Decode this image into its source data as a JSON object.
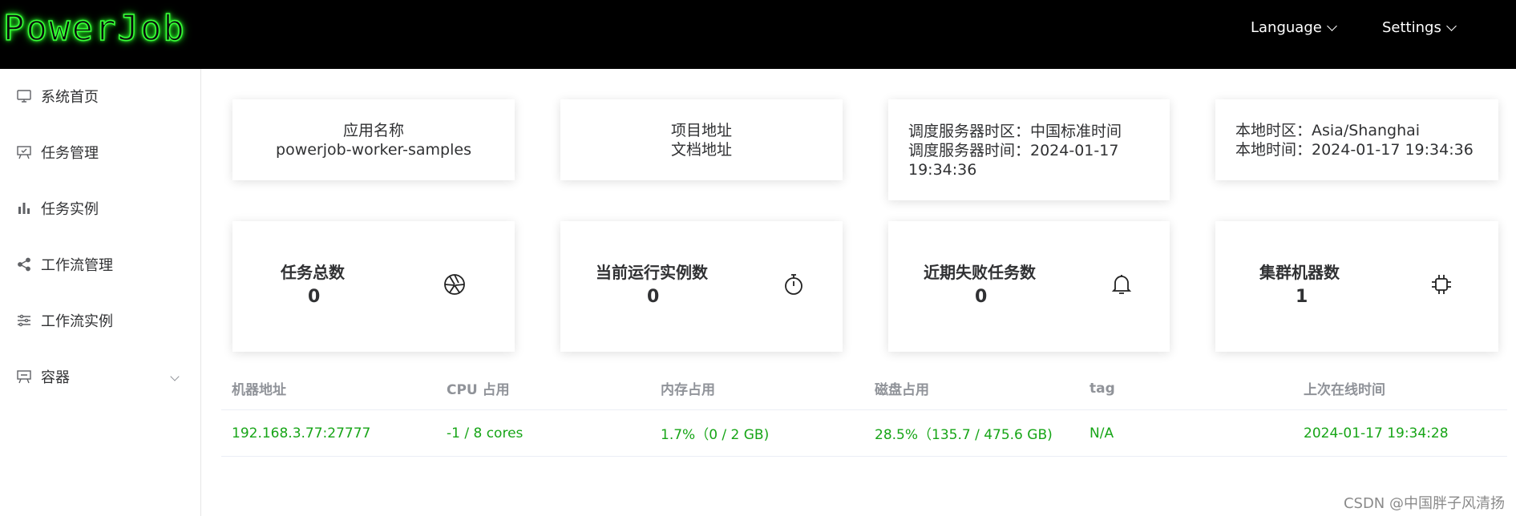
{
  "header": {
    "logo": "PowerJob",
    "language": "Language",
    "settings": "Settings"
  },
  "sidebar": {
    "items": [
      {
        "label": "系统首页",
        "icon": "monitor-icon"
      },
      {
        "label": "任务管理",
        "icon": "task-board-icon"
      },
      {
        "label": "任务实例",
        "icon": "bar-chart-icon"
      },
      {
        "label": "工作流管理",
        "icon": "share-icon"
      },
      {
        "label": "工作流实例",
        "icon": "sliders-icon"
      },
      {
        "label": "容器",
        "icon": "container-icon"
      }
    ]
  },
  "info_cards": {
    "app": {
      "line1": "应用名称",
      "line2": "powerjob-worker-samples"
    },
    "project": {
      "line1": "项目地址",
      "line2": "文档地址"
    },
    "server": {
      "line1": "调度服务器时区：中国标准时间",
      "line2": "调度服务器时间：2024-01-17",
      "line3": "19:34:36"
    },
    "local": {
      "line1": "本地时区：Asia/Shanghai",
      "line2": "本地时间：2024-01-17 19:34:36"
    }
  },
  "stats": [
    {
      "title": "任务总数",
      "value": "0",
      "icon": "aperture-icon"
    },
    {
      "title": "当前运行实例数",
      "value": "0",
      "icon": "stopwatch-icon"
    },
    {
      "title": "近期失败任务数",
      "value": "0",
      "icon": "bell-icon"
    },
    {
      "title": "集群机器数",
      "value": "1",
      "icon": "cpu-chip-icon"
    }
  ],
  "table": {
    "headers": [
      "机器地址",
      "CPU 占用",
      "内存占用",
      "磁盘占用",
      "tag",
      "上次在线时间"
    ],
    "rows": [
      [
        "192.168.3.77:27777",
        "-1 / 8 cores",
        "1.7%（0 / 2 GB)",
        "28.5%（135.7 / 475.6 GB)",
        "N/A",
        "2024-01-17 19:34:28"
      ]
    ]
  },
  "watermark": "CSDN @中国胖子风清扬",
  "colors": {
    "header_bg": "#000000",
    "logo_glow": "#39ff39",
    "table_text": "#17a517"
  }
}
